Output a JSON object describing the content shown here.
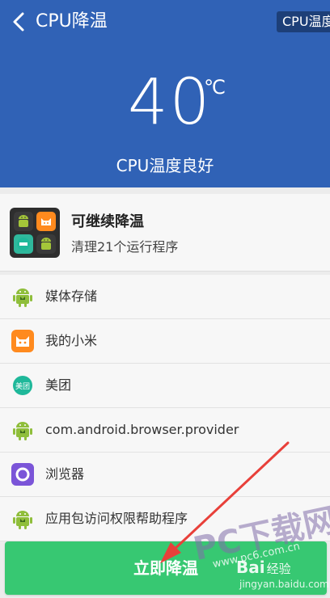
{
  "header": {
    "title": "CPU降温",
    "tag": "CPU温度",
    "temperature": "40",
    "unit": "℃",
    "status": "CPU温度良好"
  },
  "summary": {
    "title": "可继续降温",
    "subtitle": "清理21个运行程序"
  },
  "apps": [
    {
      "label": "媒体存储",
      "icon": "android-icon"
    },
    {
      "label": "我的小米",
      "icon": "xiaomi-icon"
    },
    {
      "label": "美团",
      "icon": "meituan-icon"
    },
    {
      "label": "com.android.browser.provider",
      "icon": "android-icon"
    },
    {
      "label": "浏览器",
      "icon": "browser-icon"
    },
    {
      "label": "应用包访问权限帮助程序",
      "icon": "android-icon"
    }
  ],
  "button": {
    "label": "立即降温"
  },
  "watermark": {
    "pc": "PC下载网",
    "pc_url": "www.pc6.com.cn",
    "baidu": "Bai",
    "baidu_exp": "经验",
    "baidu_url": "jingyan.baidu.com"
  },
  "colors": {
    "header_bg": "#3062b6",
    "button_bg": "#37c872",
    "arrow": "#e8403a"
  }
}
